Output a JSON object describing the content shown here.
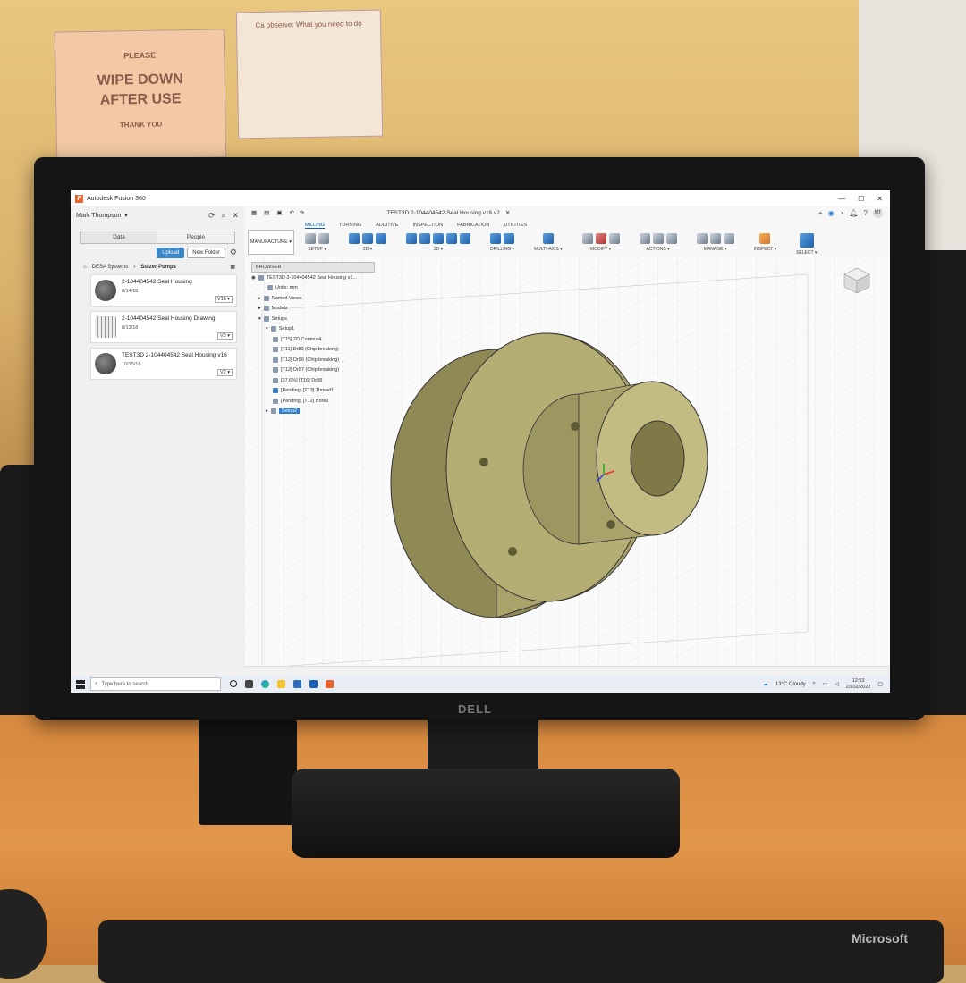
{
  "signs": {
    "sign1": {
      "line0": "PLEASE",
      "line1": "WIPE DOWN",
      "line2": "AFTER USE",
      "line3": "THANK YOU"
    },
    "sign2": {
      "heading": "Ca observe: What you need to do"
    }
  },
  "monitor": {
    "brand": "DELL"
  },
  "keyboard": {
    "brand": "Microsoft"
  },
  "window": {
    "title": "Autodesk Fusion 360",
    "controls": [
      "—",
      "☐",
      "✕"
    ]
  },
  "data_panel": {
    "user": "Mark Thompson",
    "tabs": [
      {
        "label": "Data"
      },
      {
        "label": "People"
      }
    ],
    "upload_label": "Upload",
    "new_folder_label": "New Folder",
    "breadcrumb": [
      "DESA Systems",
      "Sulzer Pumps"
    ],
    "files": [
      {
        "name": "2-104404542 Seal Housing",
        "date": "8/14/18",
        "version": "V16 ▾"
      },
      {
        "name": "2-104404542 Seal Housing Drawing",
        "date": "8/13/18",
        "version": "V3 ▾"
      },
      {
        "name": "TEST3D 2-104404542 Seal Housing v16",
        "date": "10/15/18",
        "version": "V2 ▾"
      }
    ]
  },
  "ribbon": {
    "document_title": "TEST3D 2-104404542 Seal Housing v16 v2",
    "workspace": "MANUFACTURE ▾",
    "tabs": [
      "MILLING",
      "TURNING",
      "ADDITIVE",
      "INSPECTION",
      "FABRICATION",
      "UTILITIES"
    ],
    "active_tab": "MILLING",
    "groups": [
      {
        "label": "SETUP ▾"
      },
      {
        "label": "2D ▾"
      },
      {
        "label": "3D ▾"
      },
      {
        "label": "DRILLING ▾"
      },
      {
        "label": "MULTI-AXIS ▾"
      },
      {
        "label": "MODIFY ▾"
      },
      {
        "label": "ACTIONS ▾"
      },
      {
        "label": "MANAGE ▾"
      },
      {
        "label": "INSPECT ▾"
      },
      {
        "label": "SELECT ▾"
      }
    ],
    "user_initials": "MT"
  },
  "browser": {
    "header": "BROWSER",
    "rows": [
      {
        "label": "TEST3D 2-104404542 Seal Housing v1..."
      },
      {
        "label": "Units: mm"
      },
      {
        "label": "Named Views"
      },
      {
        "label": "Models"
      },
      {
        "label": "Setups"
      },
      {
        "label": "Setup1"
      },
      {
        "label": "[T15] 2D Contour4"
      },
      {
        "label": "[T11] Dr80 (Chip breaking)"
      },
      {
        "label": "[T12] Dr86 (Chip breaking)"
      },
      {
        "label": "[T12] Dr87 (Chip breaking)"
      },
      {
        "label": "[27.6%] [T16] Dr88"
      },
      {
        "label": "[Pending] [T13] Thread1"
      },
      {
        "label": "[Pending] [T12] Bore2"
      },
      {
        "label": "Setup2"
      }
    ]
  },
  "taskbar": {
    "search_placeholder": "Type here to search",
    "weather": "13°C Cloudy",
    "time": "12:53",
    "date": "23/02/2022"
  },
  "colors": {
    "accent_blue": "#2a7fd4",
    "fusion_orange": "#e8652f",
    "model_olive": "#a7a066"
  }
}
